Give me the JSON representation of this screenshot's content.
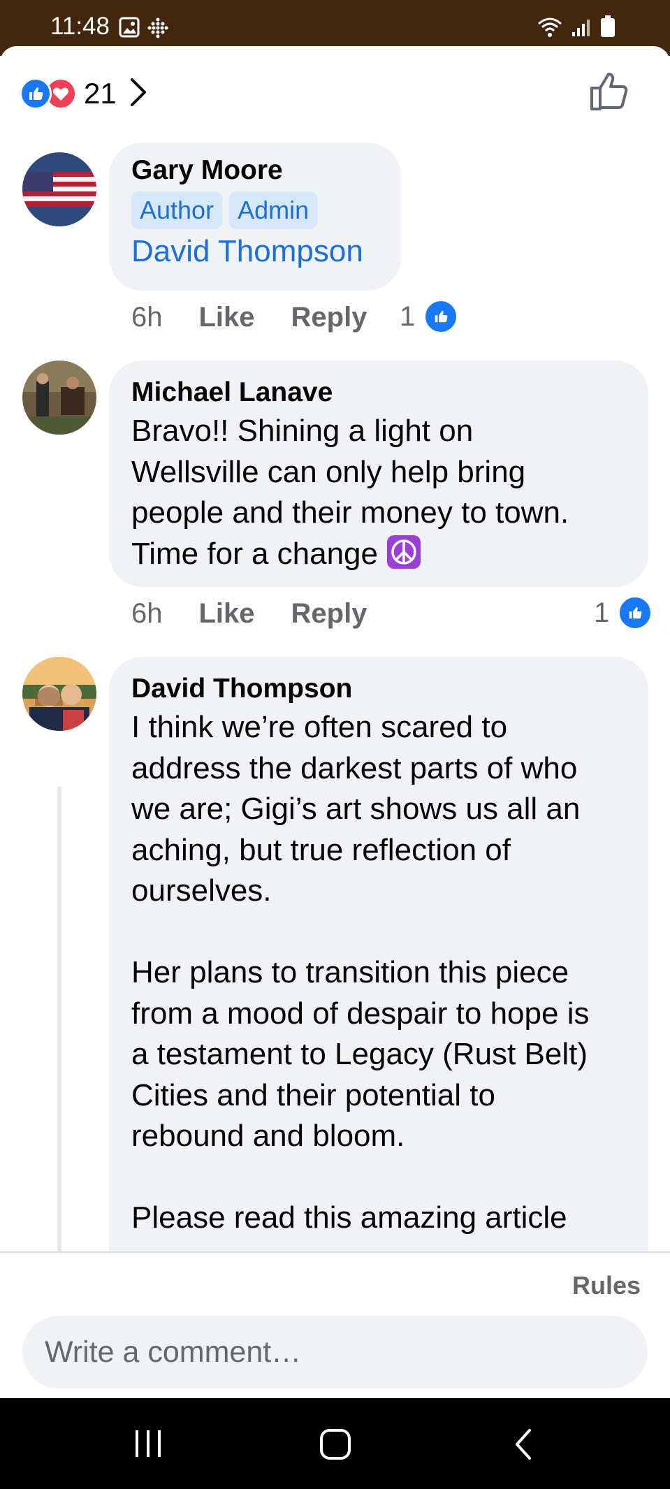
{
  "status_bar": {
    "time": "11:48"
  },
  "reactions": {
    "count": "21"
  },
  "comments": [
    {
      "author": "Gary Moore",
      "badges": [
        "Author",
        "Admin"
      ],
      "mention": "David Thompson",
      "time": "6h",
      "like_label": "Like",
      "reply_label": "Reply",
      "like_count": "1"
    },
    {
      "author": "Michael Lanave",
      "text": "Bravo!! Shining a light on\nWellsville can only help bring\npeople and their money to town.\nTime for a change",
      "time": "6h",
      "like_label": "Like",
      "reply_label": "Reply",
      "like_count": "1"
    },
    {
      "author": "David Thompson",
      "text": "I think we’re often scared to\naddress the darkest parts of who\nwe are; Gigi’s art shows us all an\naching, but true reflection of\nourselves.\n\nHer plans to transition this piece\nfrom a mood of despair to hope is\na testament to Legacy (Rust Belt)\nCities and their potential to\nrebound and bloom.\n\nPlease read this amazing article"
    }
  ],
  "composer": {
    "rules_label": "Rules",
    "placeholder": "Write a comment…"
  },
  "colors": {
    "status_bar": "#43260e",
    "bubble": "#f0f2f5",
    "link_blue": "#1b6fd6",
    "like_blue": "#1877f2",
    "love_red": "#f33e58"
  }
}
